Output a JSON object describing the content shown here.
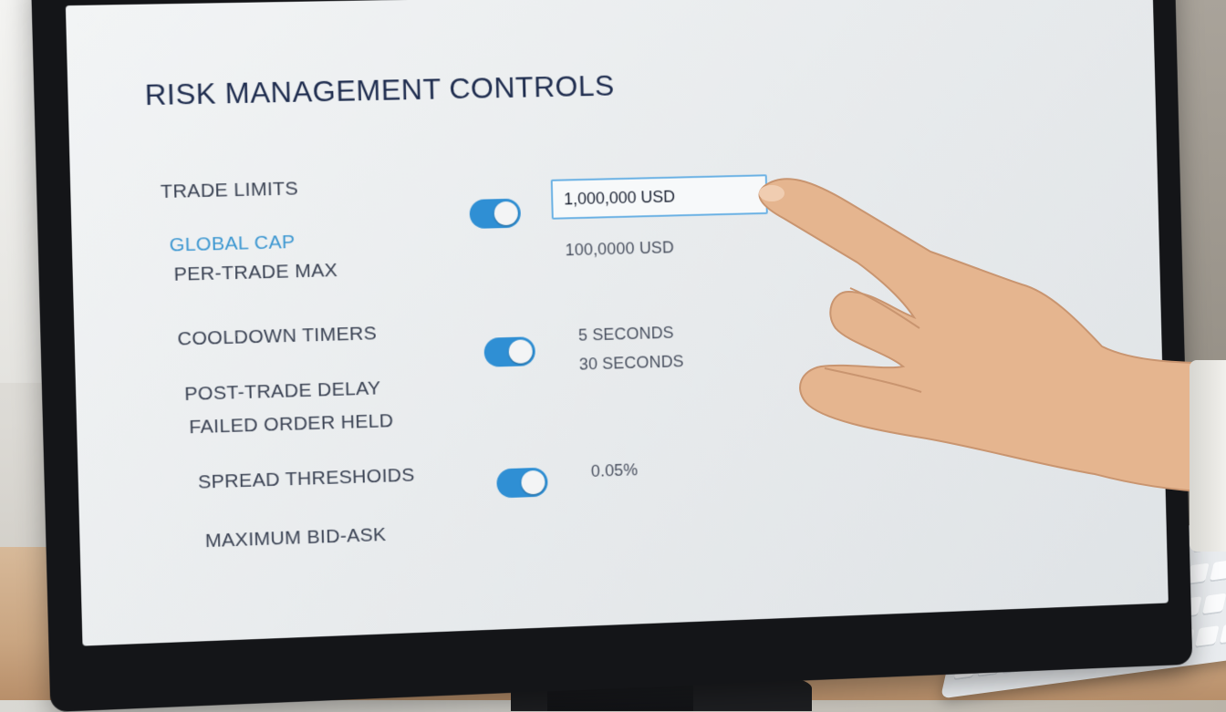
{
  "panel": {
    "title": "RISK MANAGEMENT CONTROLS"
  },
  "sections": {
    "trade_limits": {
      "label": "TRADE LIMITS",
      "items": [
        "GLOBAL CAP",
        "PER-TRADE MAX"
      ],
      "toggle_on": true,
      "input_value": "1,000,000 USD",
      "secondary_value": "100,0000 USD"
    },
    "cooldown_timers": {
      "label": "COOLDOWN TIMERS",
      "items": [
        "POST-TRADE DELAY",
        "FAILED ORDER HELD"
      ],
      "toggle_on": true,
      "values": [
        "5 SECONDS",
        "30 SECONDS"
      ]
    },
    "spread_thresholds": {
      "label": "SPREAD THRESHOIDS",
      "items": [
        "MAXIMUM BID-ASK"
      ],
      "toggle_on": true,
      "value": "0.05%"
    }
  },
  "colors": {
    "accent": "#2f8fd4",
    "title": "#1f2d4f",
    "active_label": "#3c97d1"
  }
}
